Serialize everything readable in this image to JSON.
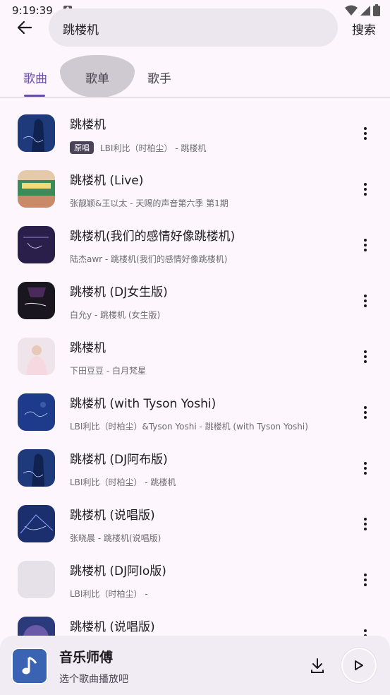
{
  "status_bar": {
    "time": "9:19:39",
    "notification_letter": "A"
  },
  "search": {
    "query": "跳楼机",
    "search_label": "搜索"
  },
  "tabs": [
    {
      "label": "歌曲",
      "active": true
    },
    {
      "label": "歌单",
      "active": false
    },
    {
      "label": "歌手",
      "active": false
    }
  ],
  "songs": [
    {
      "title": "跳楼机",
      "badge": "原唱",
      "meta": "LBI利比（时柏尘） - 跳楼机",
      "cover_color": "#1f3a7a"
    },
    {
      "title": "跳楼机 (Live)",
      "meta": "张靓颖&王以太 - 天赐的声音第六季 第1期",
      "cover_color": "#e6c9a8"
    },
    {
      "title": "跳楼机(我们的感情好像跳楼机)",
      "meta": "陆杰awr - 跳楼机(我们的感情好像跳楼机)",
      "cover_color": "#2a1f4a"
    },
    {
      "title": "跳楼机 (DJ女生版)",
      "meta": "白允y - 跳楼机 (女生版)",
      "cover_color": "#1a1620"
    },
    {
      "title": "跳楼机",
      "meta": "下田豆豆 - 白月梵星",
      "cover_color": "#efe4ea"
    },
    {
      "title": "跳楼机 (with Tyson Yoshi)",
      "meta": "LBI利比（时柏尘）&Tyson Yoshi - 跳楼机 (with Tyson Yoshi)",
      "cover_color": "#1d3b8a"
    },
    {
      "title": "跳楼机 (DJ阿布版)",
      "meta": "LBI利比（时柏尘） - 跳楼机",
      "cover_color": "#1f3a7a"
    },
    {
      "title": "跳楼机 (说唱版)",
      "meta": "张晓晨 - 跳楼机(说唱版)",
      "cover_color": "#1b2e6e"
    },
    {
      "title": "跳楼机 (DJ阿lo版)",
      "meta": "LBI利比（时柏尘） -",
      "cover_color": "#e6e0e9"
    },
    {
      "title": "跳楼机 (说唱版)",
      "meta": "",
      "cover_color": "#2a3a7a"
    }
  ],
  "player": {
    "title": "音乐师傅",
    "subtitle": "选个歌曲播放吧"
  },
  "colors": {
    "accent": "#6750a4",
    "background": "#fdf7fd",
    "player_cover": "#3b63b3"
  }
}
